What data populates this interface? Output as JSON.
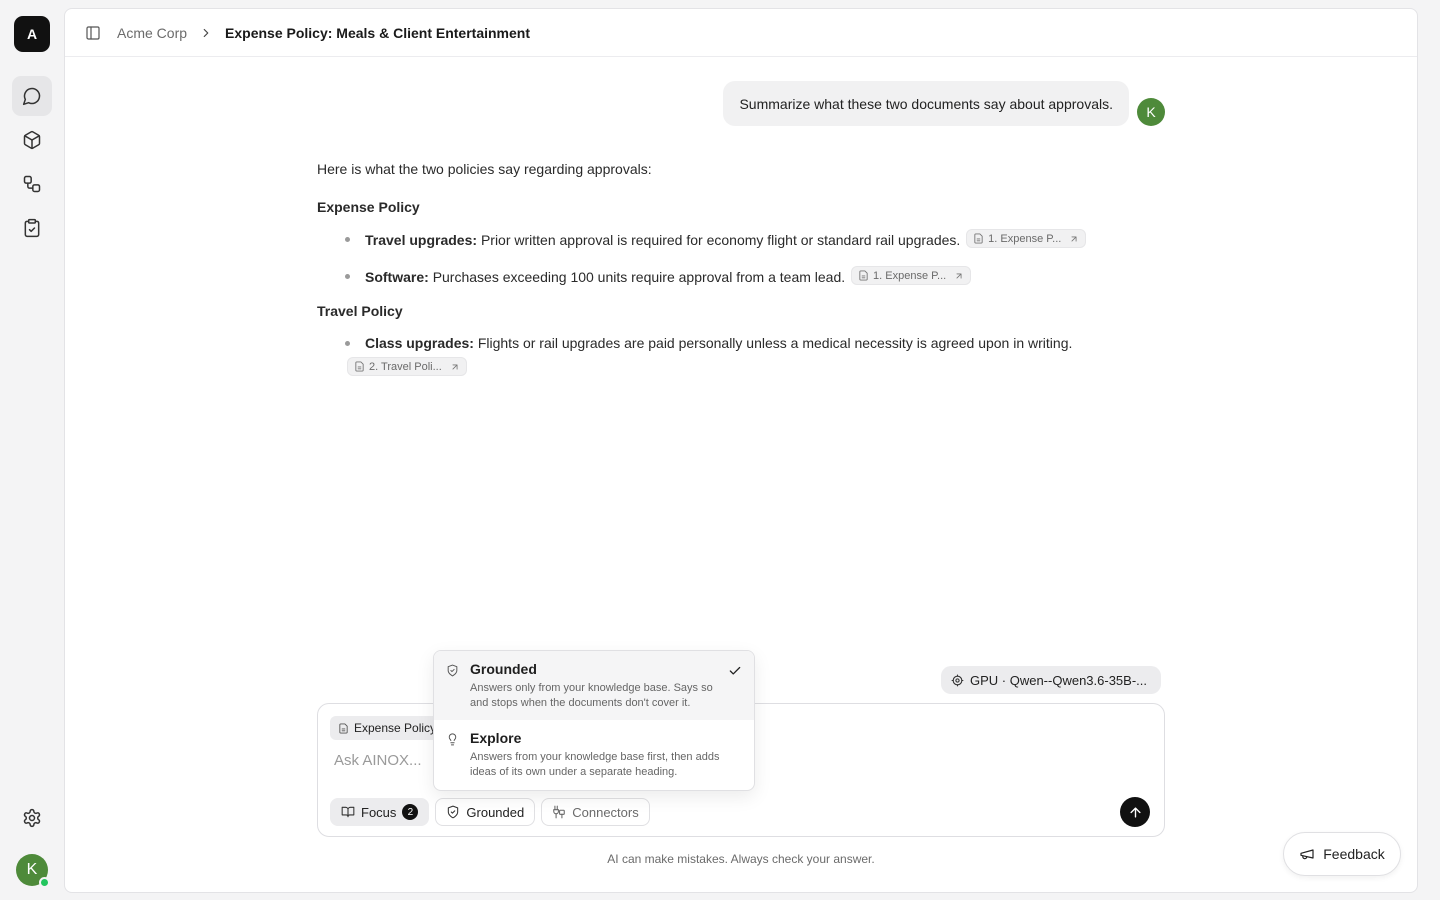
{
  "app": {
    "logo_letter": "A"
  },
  "rail": {
    "items": [
      {
        "icon": "chat-icon",
        "active": true
      },
      {
        "icon": "cube-icon",
        "active": false
      },
      {
        "icon": "workflow-icon",
        "active": false
      },
      {
        "icon": "clipboard-check-icon",
        "active": false
      }
    ],
    "user_initial": "K"
  },
  "breadcrumb": {
    "parent": "Acme Corp",
    "current": "Expense Policy: Meals & Client Entertainment"
  },
  "conversation": {
    "user_message": "Summarize what these two documents say about approvals.",
    "user_initial": "K",
    "answer": {
      "intro": "Here is what the two policies say regarding approvals:",
      "sections": [
        {
          "heading": "Expense Policy",
          "items": [
            {
              "label": "Travel upgrades:",
              "text": "Prior written approval is required for economy flight or standard rail upgrades.",
              "citation": "1. Expense P..."
            },
            {
              "label": "Software:",
              "text": "Purchases exceeding 100 units require approval from a team lead.",
              "citation": "1. Expense P..."
            }
          ]
        },
        {
          "heading": "Travel Policy",
          "items": [
            {
              "label": "Class upgrades:",
              "text": "Flights or rail upgrades are paid personally unless a medical necessity is agreed upon in writing.",
              "citation": "2. Travel Poli..."
            }
          ]
        }
      ]
    }
  },
  "model_selector": {
    "label": "GPU · Qwen--Qwen3.6-35B-..."
  },
  "composer": {
    "attached_doc": "Expense Policy",
    "placeholder": "Ask AINOX...",
    "value": "",
    "focus_label": "Focus",
    "focus_count": "2",
    "mode_label": "Grounded",
    "connectors_label": "Connectors"
  },
  "mode_menu": {
    "options": [
      {
        "title": "Grounded",
        "description": "Answers only from your knowledge base. Says so and stops when the documents don't cover it.",
        "selected": true
      },
      {
        "title": "Explore",
        "description": "Answers from your knowledge base first, then adds ideas of its own under a separate heading.",
        "selected": false
      }
    ]
  },
  "disclaimer": "AI can make mistakes. Always check your answer.",
  "feedback_label": "Feedback",
  "colors": {
    "accent": "#111111",
    "avatar": "#4e8a3a",
    "online": "#22c55e"
  }
}
